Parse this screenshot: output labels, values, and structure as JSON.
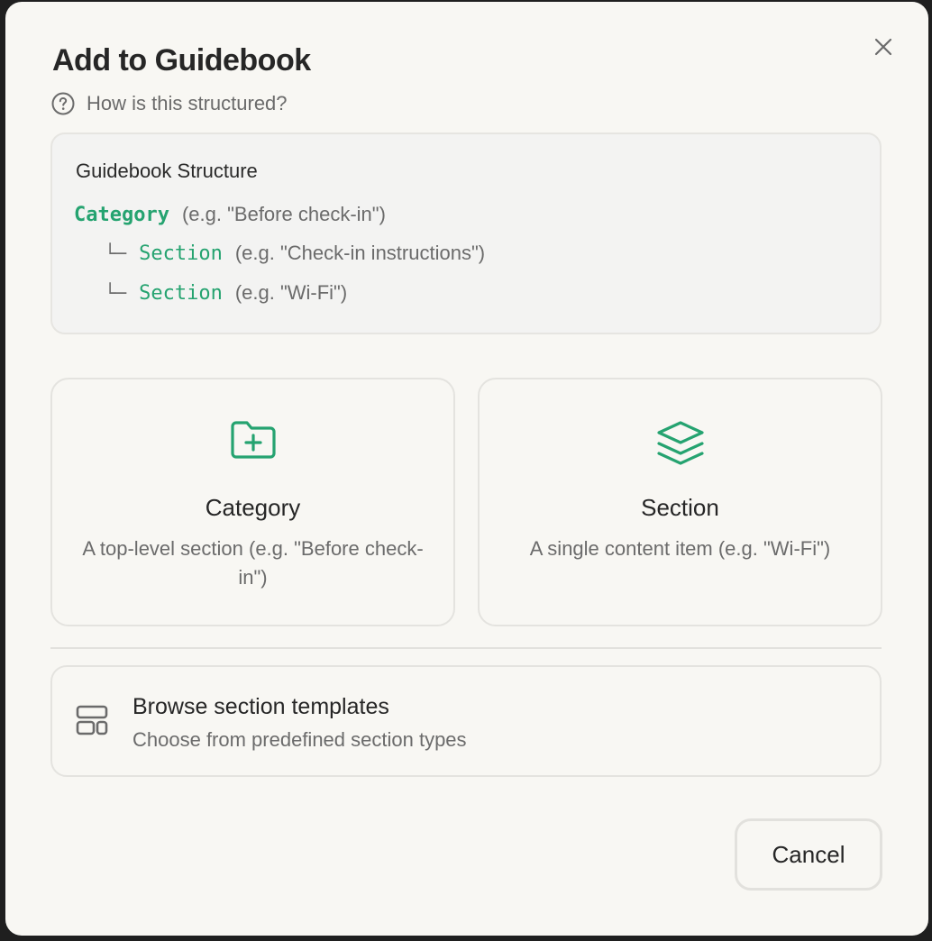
{
  "dialog": {
    "title": "Add to Guidebook",
    "help_text": "How is this structured?"
  },
  "structure": {
    "title": "Guidebook Structure",
    "lines": [
      {
        "keyword": "Category",
        "example": "(e.g. \"Before check-in\")"
      },
      {
        "connector": "└─",
        "keyword": "Section",
        "example": "(e.g. \"Check-in instructions\")"
      },
      {
        "connector": "└─",
        "keyword": "Section",
        "example": "(e.g. \"Wi-Fi\")"
      }
    ]
  },
  "options": {
    "category": {
      "icon": "folder-plus-icon",
      "title": "Category",
      "description": "A top-level section (e.g. \"Before check-in\")"
    },
    "section": {
      "icon": "layers-icon",
      "title": "Section",
      "description": "A single content item (e.g. \"Wi-Fi\")"
    }
  },
  "templates": {
    "icon": "layout-template-icon",
    "title": "Browse section templates",
    "description": "Choose from predefined section types"
  },
  "footer": {
    "cancel_label": "Cancel"
  },
  "colors": {
    "accent_green": "#25a370",
    "text_primary": "#262626",
    "text_secondary": "#6b6b6b",
    "background": "#f8f7f3"
  }
}
